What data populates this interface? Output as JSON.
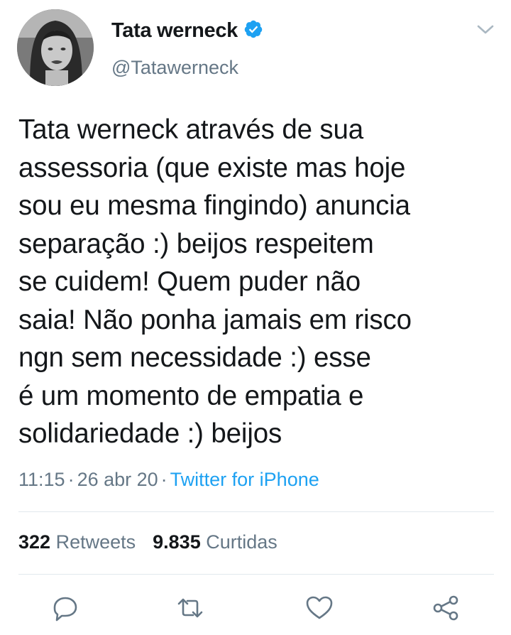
{
  "author": {
    "name": "Tata werneck",
    "handle": "@Tatawerneck",
    "verified_icon": "verified-badge-icon",
    "verified_color": "#1da1f2"
  },
  "tweet": {
    "text": "Tata werneck através de sua\nassessoria (que existe mas hoje\nsou eu mesma fingindo) anuncia\nseparação :) beijos respeitem\nse cuidem! Quem puder não\nsaia! Não ponha jamais em risco\nngn sem necessidade :) esse\né um momento de empatia e\nsolidariedade :) beijos",
    "time": "11:15",
    "date": "26 abr 20",
    "separator": "·",
    "source": "Twitter for iPhone"
  },
  "stats": {
    "retweets_count": "322",
    "retweets_label": "Retweets",
    "likes_count": "9.835",
    "likes_label": "Curtidas"
  },
  "actions": {
    "icons": [
      "reply-icon",
      "retweet-icon",
      "like-icon",
      "share-icon"
    ],
    "icon_color": "#657786"
  },
  "colors": {
    "text": "#14171a",
    "secondary": "#657786",
    "link": "#1da1f2",
    "divider": "#e1e8ed"
  }
}
